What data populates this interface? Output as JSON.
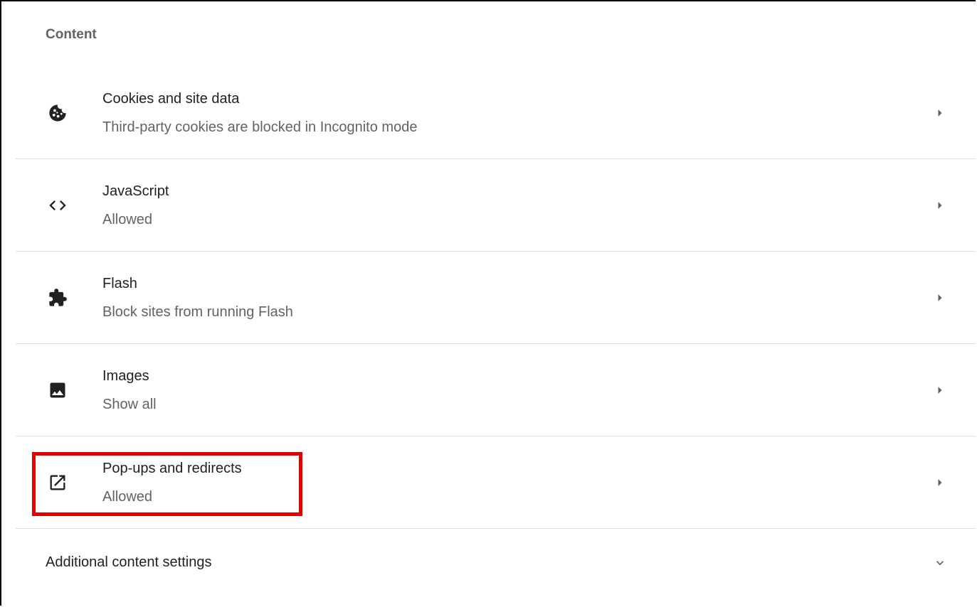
{
  "section": {
    "title": "Content"
  },
  "items": [
    {
      "label": "Cookies and site data",
      "sublabel": "Third-party cookies are blocked in Incognito mode",
      "icon": "cookie-icon"
    },
    {
      "label": "JavaScript",
      "sublabel": "Allowed",
      "icon": "code-icon"
    },
    {
      "label": "Flash",
      "sublabel": "Block sites from running Flash",
      "icon": "puzzle-icon"
    },
    {
      "label": "Images",
      "sublabel": "Show all",
      "icon": "image-icon"
    },
    {
      "label": "Pop-ups and redirects",
      "sublabel": "Allowed",
      "icon": "open-in-new-icon"
    }
  ],
  "additional": {
    "label": "Additional content settings",
    "icon": "chevron-down-icon"
  },
  "colors": {
    "highlight": "#e00000",
    "icon": "#5f6368",
    "divider": "#e0e0e0"
  }
}
